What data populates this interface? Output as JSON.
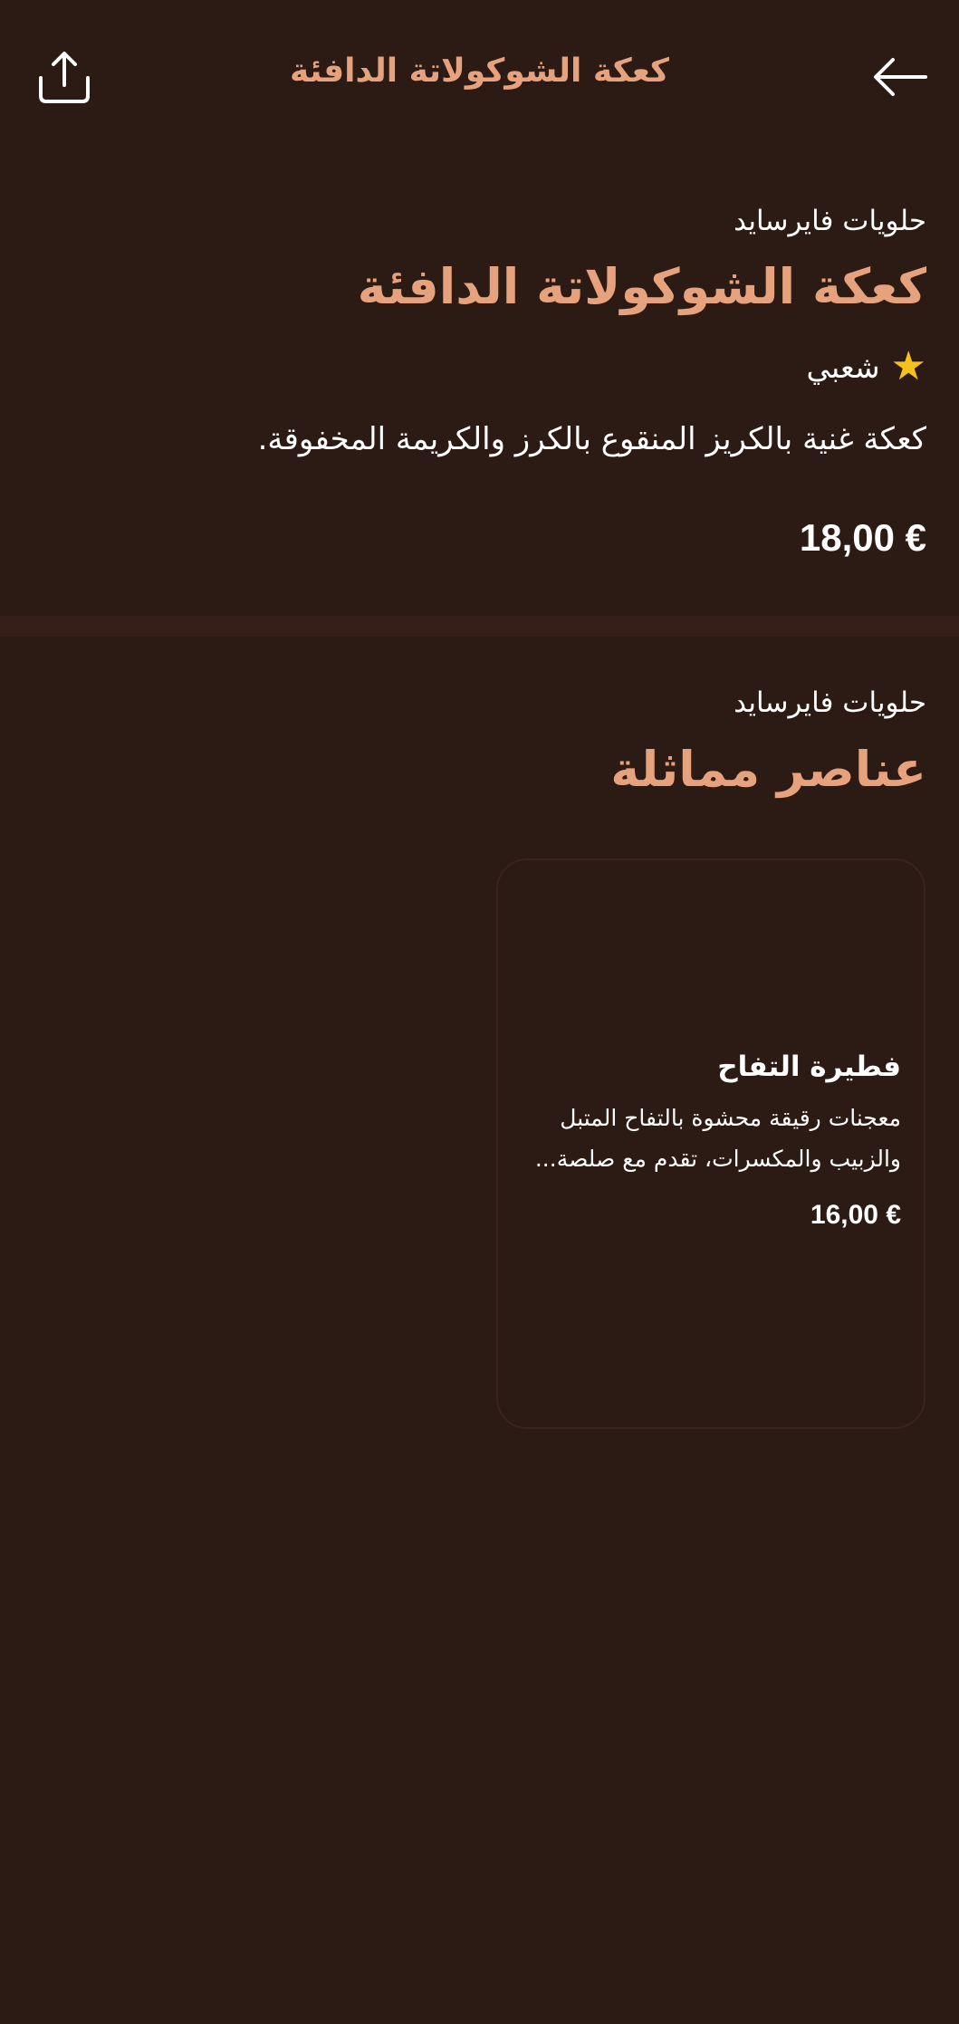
{
  "header": {
    "title": "كعكة الشوكولاتة الدافئة",
    "share_icon": "share-icon",
    "back_icon": "arrow-back-icon"
  },
  "product": {
    "store": "حلويات فايرسايد",
    "title": "كعكة الشوكولاتة الدافئة",
    "badge": "شعبي",
    "badge_icon": "star-icon",
    "description": "كعكة غنية بالكريز المنقوع بالكرز والكريمة المخفوقة.",
    "price": "18,00 €"
  },
  "similar": {
    "store": "حلويات فايرسايد",
    "title": "عناصر مماثلة",
    "items": [
      {
        "name": "فطيرة التفاح",
        "description": "معجنات رقيقة محشوة بالتفاح المتبل والزبيب والمكسرات، تقدم مع صلصة...",
        "price": "16,00 €"
      }
    ]
  },
  "colors": {
    "background": "#2c1a14",
    "accent": "#e6a27c",
    "star": "#f5c21b",
    "divider": "#351f18"
  }
}
